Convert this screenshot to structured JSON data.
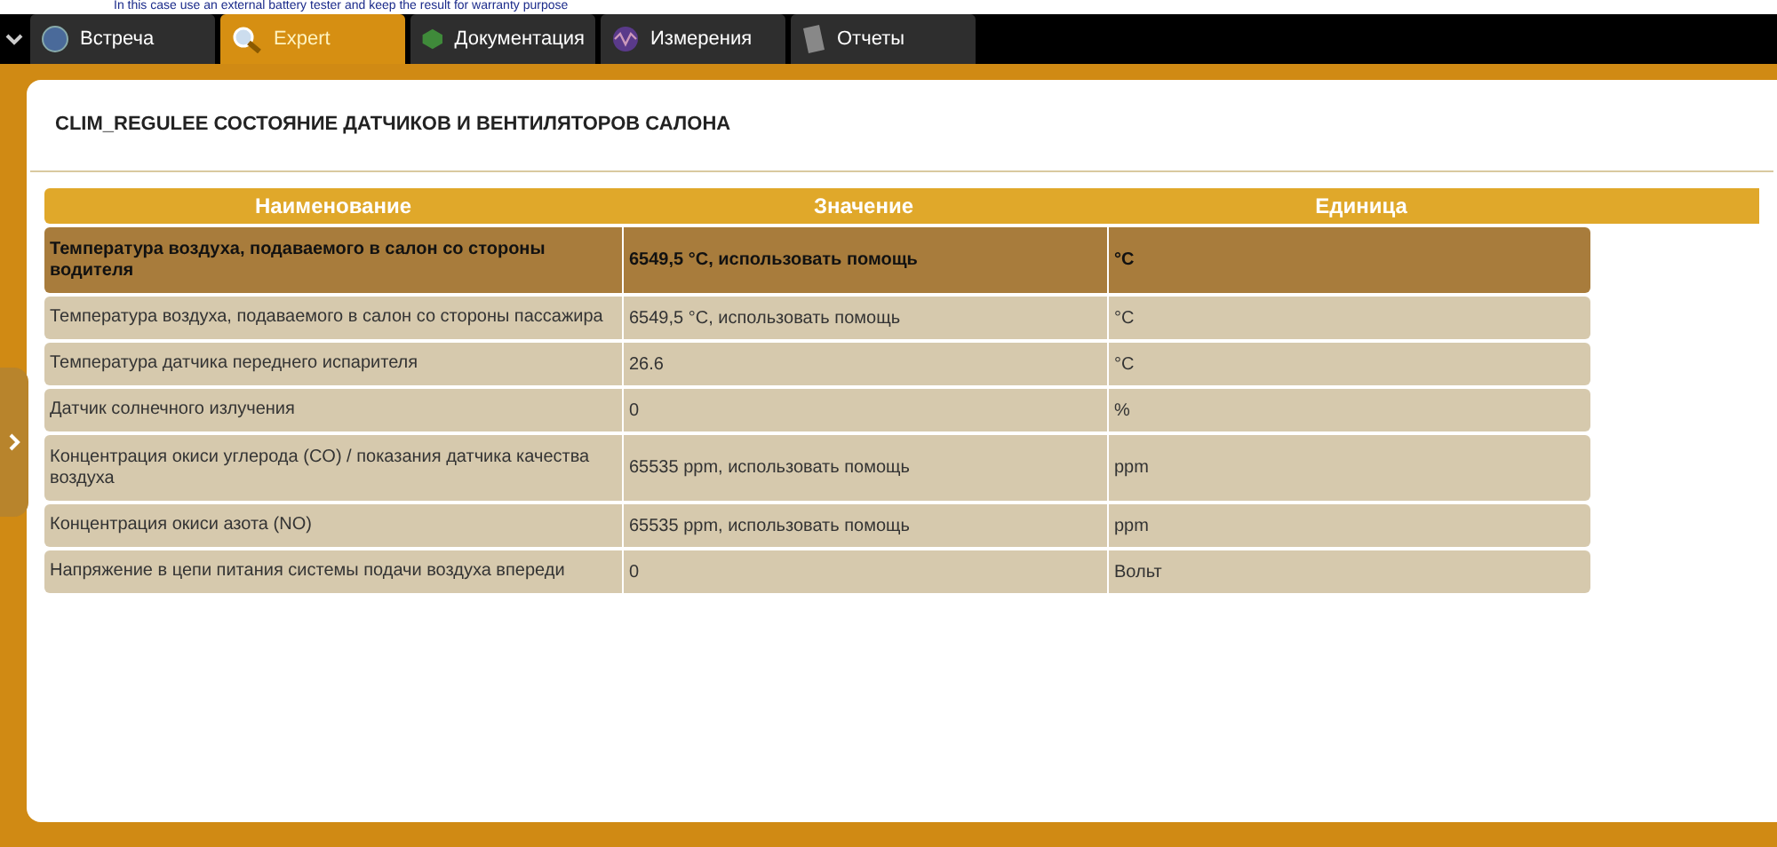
{
  "notice": "In this case use an external battery tester and keep the result for warranty purpose",
  "tabs": [
    {
      "label": "Встреча",
      "selected": false
    },
    {
      "label": "Expert",
      "selected": true
    },
    {
      "label": "Документация",
      "selected": false
    },
    {
      "label": "Измерения",
      "selected": false
    },
    {
      "label": "Отчеты",
      "selected": false
    }
  ],
  "panel": {
    "title": "CLIM_REGULEE  СОСТОЯНИЕ ДАТЧИКОВ И ВЕНТИЛЯТОРОВ САЛОНА"
  },
  "table": {
    "columns": [
      "Наименование",
      "Значение",
      "Единица"
    ],
    "rows": [
      {
        "name": "Температура воздуха, подаваемого в салон со стороны водителя",
        "value": "6549,5 °C, использовать помощь",
        "unit": "°C",
        "selected": true
      },
      {
        "name": "Температура воздуха, подаваемого в салон со стороны пассажира",
        "value": "6549,5 °C, использовать помощь",
        "unit": "°C",
        "selected": false
      },
      {
        "name": "Температура датчика переднего испарителя",
        "value": "26.6",
        "unit": "°C",
        "selected": false
      },
      {
        "name": "Датчик солнечного излучения",
        "value": "0",
        "unit": "%",
        "selected": false
      },
      {
        "name": "Концентрация окиси углерода (CO) / показания датчика качества воздуха",
        "value": "65535 ppm, использовать помощь",
        "unit": "ppm",
        "selected": false
      },
      {
        "name": "Концентрация окиси азота (NO)",
        "value": "65535 ppm, использовать помощь",
        "unit": "ppm",
        "selected": false
      },
      {
        "name": "Напряжение в цепи питания системы подачи воздуха впереди",
        "value": "0",
        "unit": "Вольт",
        "selected": false
      }
    ]
  }
}
